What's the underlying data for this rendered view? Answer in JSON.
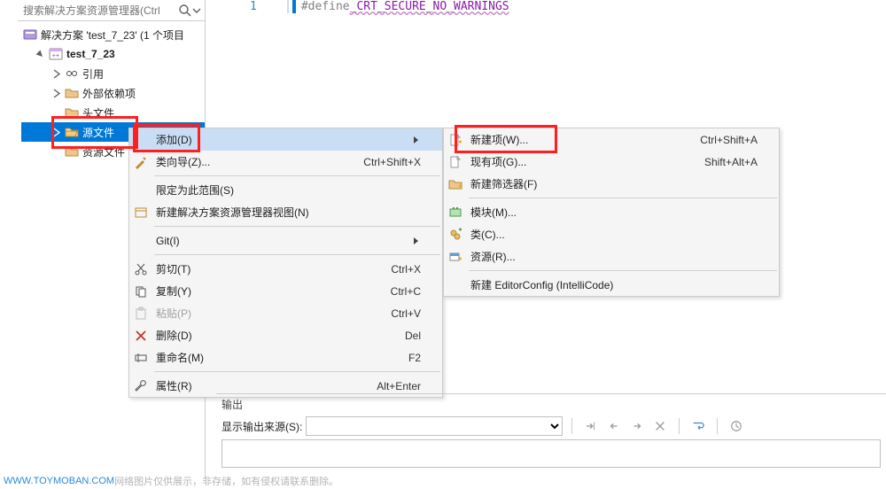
{
  "sidebar": {
    "search_placeholder": "搜索解决方案资源管理器(Ctrl",
    "solution_row": "解决方案 'test_7_23' (1 个项目",
    "project": "test_7_23",
    "items": [
      "引用",
      "外部依赖项",
      "头文件",
      "源文件",
      "资源文件"
    ]
  },
  "editor": {
    "line_no": "1",
    "directive": "#define ",
    "macro": "_CRT_SECURE_NO_WARNINGS"
  },
  "menu1": {
    "add": "添加(D)",
    "class_wizard": "类向导(Z)...",
    "class_wizard_sc": "Ctrl+Shift+X",
    "scope": "限定为此范围(S)",
    "new_view": "新建解决方案资源管理器视图(N)",
    "git": "Git(I)",
    "cut": "剪切(T)",
    "cut_sc": "Ctrl+X",
    "copy": "复制(Y)",
    "copy_sc": "Ctrl+C",
    "paste": "粘贴(P)",
    "paste_sc": "Ctrl+V",
    "delete": "删除(D)",
    "delete_sc": "Del",
    "rename": "重命名(M)",
    "rename_sc": "F2",
    "properties": "属性(R)",
    "properties_sc": "Alt+Enter"
  },
  "menu2": {
    "new_item": "新建项(W)...",
    "new_item_sc": "Ctrl+Shift+A",
    "existing_item": "现有项(G)...",
    "existing_item_sc": "Shift+Alt+A",
    "new_filter": "新建筛选器(F)",
    "module": "模块(M)...",
    "cls": "类(C)...",
    "resource": "资源(R)...",
    "editorconfig": "新建 EditorConfig (IntelliCode)"
  },
  "output": {
    "title": "输出",
    "source_lbl": "显示输出来源(S):"
  },
  "footer": {
    "site": "WWW.TOYMOBAN.COM",
    "text": "  网络图片仅供展示，非存储，如有侵权请联系删除。"
  }
}
